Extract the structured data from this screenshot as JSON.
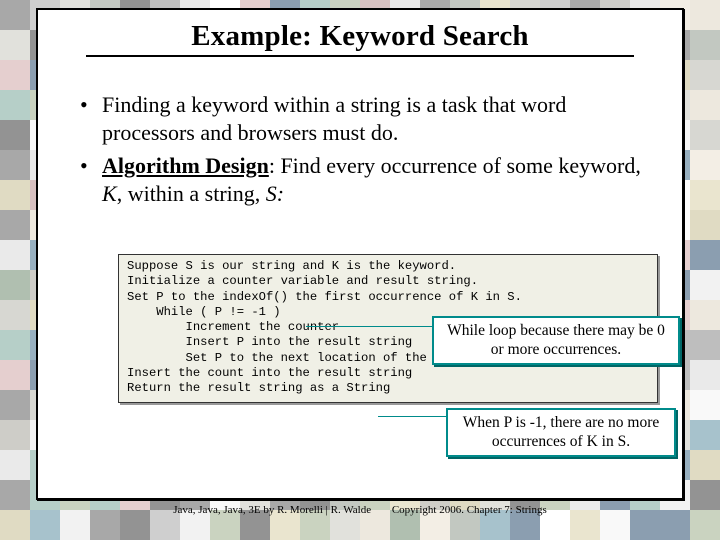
{
  "title": "Example: Keyword Search",
  "bullets": {
    "b1": "Finding a keyword within a string is a task that word processors and browsers must do.",
    "b2_bold": "Algorithm Design",
    "b2_rest_a": ": Find every occurrence of some keyword, ",
    "b2_k": "K",
    "b2_rest_b": ", within a string, ",
    "b2_s": "S:"
  },
  "code": {
    "l1": "Suppose S is our string and K is the keyword.",
    "l2": "Initialize a counter variable and result string.",
    "l3": "Set P to the indexOf() the first occurrence of K in S.",
    "l4": "    While ( P != -1 )",
    "l5": "        Increment the counter",
    "l6": "        Insert P into the result string",
    "l7": "        Set P to the next location of the keyword in S",
    "l8": "Insert the count into the result string",
    "l9": "Return the result string as a String"
  },
  "callouts": {
    "c1": "While loop because there may be 0 or more occurrences.",
    "c2": "When P is -1, there are no more occurrences of K in S."
  },
  "footer": {
    "left": "Java, Java, Java, 3E by R. Morelli | R. Walde",
    "right": "Copyright 2006.  Chapter 7: Strings"
  },
  "mosaic_colors": [
    "#e8e8e8",
    "#d9d9d9",
    "#c9c8c0",
    "#b7b6ad",
    "#a5a49a",
    "#8f9a8e",
    "#7aa89b",
    "#5e8fa3",
    "#436f8c",
    "#2c4e70",
    "#3a3a3a",
    "#606060",
    "#888888",
    "#a8a8a8",
    "#cfa8a8",
    "#b78c8c",
    "#d9cfa8",
    "#c7be92",
    "#9eae8c",
    "#708a70",
    "#f4f4f4",
    "#ffffff",
    "#eae0cf",
    "#dfd5c2"
  ]
}
